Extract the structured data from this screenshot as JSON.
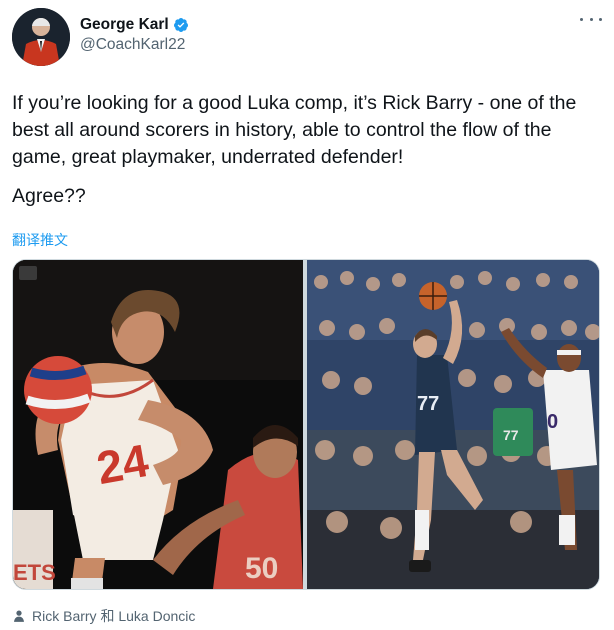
{
  "author": {
    "display_name": "George Karl",
    "handle": "@CoachKarl22",
    "verified": true
  },
  "tweet": {
    "paragraphs": [
      "If you’re looking for a good Luka comp, it’s Rick Barry - one of the best all around scorers in history, able to control the flow of the game, great playmaker, underrated defender!",
      "Agree??"
    ],
    "translate_label": "翻译推文"
  },
  "media": {
    "left_photo": {
      "jersey_number": "24",
      "description_icon": "basketball-photo"
    },
    "right_photo": {
      "jersey_numbers": [
        "77",
        "0"
      ],
      "description_icon": "basketball-photo"
    }
  },
  "tagged_people": {
    "text": "Rick Barry 和 Luka Doncic"
  },
  "colors": {
    "link": "#1d9bf0",
    "secondary_text": "#536471",
    "verified": "#1d9bf0"
  }
}
